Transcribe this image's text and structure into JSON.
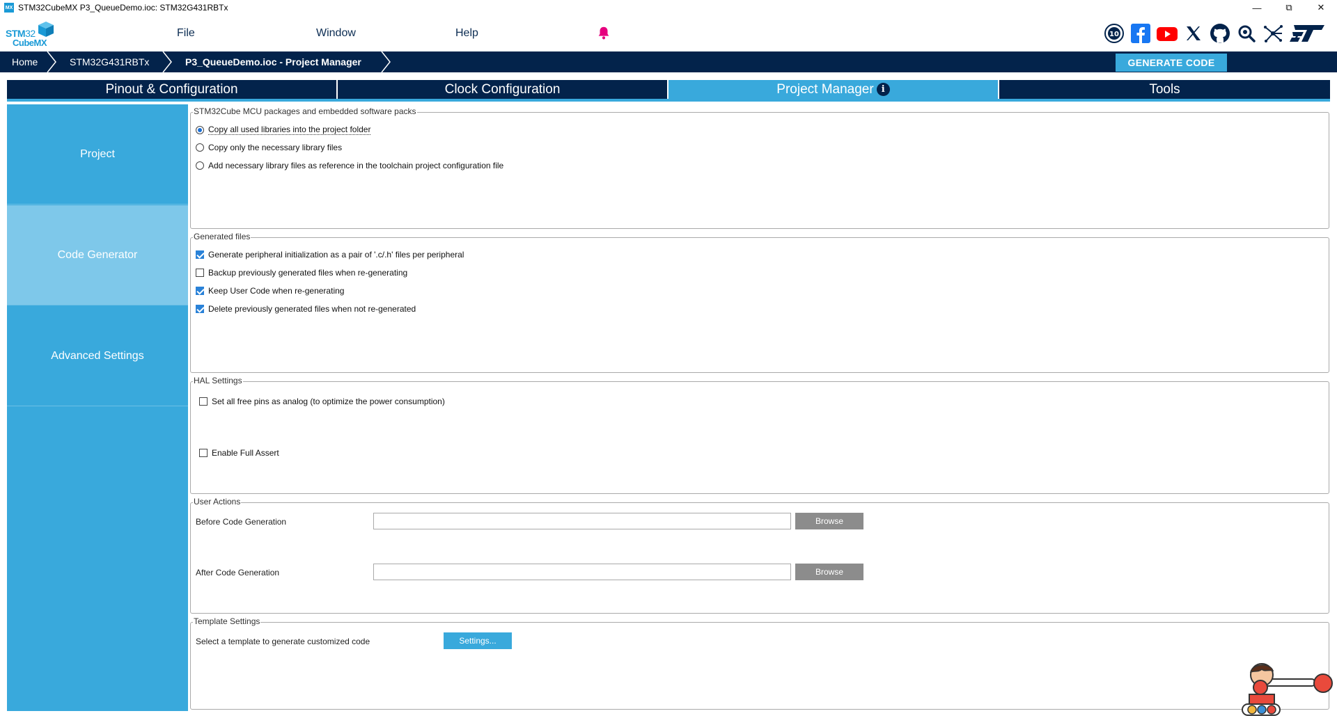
{
  "window": {
    "title": "STM32CubeMX P3_QueueDemo.ioc: STM32G431RBTx",
    "app_icon_text": "MX",
    "controls": [
      "—",
      "⧉",
      "✕"
    ]
  },
  "logo": {
    "line1_bold": "STM",
    "line1_thin": "32",
    "line2": "CubeMX"
  },
  "menu": {
    "items": [
      "File",
      "Window",
      "Help"
    ]
  },
  "breadcrumb": {
    "items": [
      "Home",
      "STM32G431RBTx",
      "P3_QueueDemo.ioc - Project Manager"
    ]
  },
  "generate_button": "GENERATE CODE",
  "tabs": [
    {
      "label": "Pinout & Configuration",
      "active": false
    },
    {
      "label": "Clock Configuration",
      "active": false
    },
    {
      "label": "Project Manager",
      "active": true,
      "info": "i"
    },
    {
      "label": "Tools",
      "active": false
    }
  ],
  "sidebar": {
    "items": [
      {
        "label": "Project",
        "active": false
      },
      {
        "label": "Code Generator",
        "active": true
      },
      {
        "label": "Advanced Settings",
        "active": false
      }
    ]
  },
  "packages": {
    "title": "STM32Cube MCU packages and embedded software packs",
    "options": [
      {
        "label": "Copy all used libraries into the project folder",
        "selected": true
      },
      {
        "label": "Copy only the necessary library files",
        "selected": false
      },
      {
        "label": "Add necessary library files as reference in the toolchain project configuration file",
        "selected": false
      }
    ]
  },
  "generated_files": {
    "title": "Generated files",
    "options": [
      {
        "label": "Generate peripheral initialization as a pair of '.c/.h' files per peripheral",
        "checked": true
      },
      {
        "label": "Backup previously generated files when re-generating",
        "checked": false
      },
      {
        "label": "Keep User Code when re-generating",
        "checked": true
      },
      {
        "label": "Delete previously generated files when not re-generated",
        "checked": true
      }
    ]
  },
  "hal_settings": {
    "title": "HAL Settings",
    "options": [
      {
        "label": "Set all free pins as analog (to optimize the power consumption)",
        "checked": false
      },
      {
        "label": "Enable Full Assert",
        "checked": false
      }
    ]
  },
  "user_actions": {
    "title": "User Actions",
    "before_label": "Before Code Generation",
    "before_value": "",
    "after_label": "After Code Generation",
    "after_value": "",
    "browse_label": "Browse"
  },
  "template_settings": {
    "title": "Template Settings",
    "label": "Select a template to generate customized code",
    "button": "Settings..."
  },
  "colors": {
    "navy": "#03234b",
    "accent": "#39a9dc",
    "bell": "#e6007e"
  }
}
